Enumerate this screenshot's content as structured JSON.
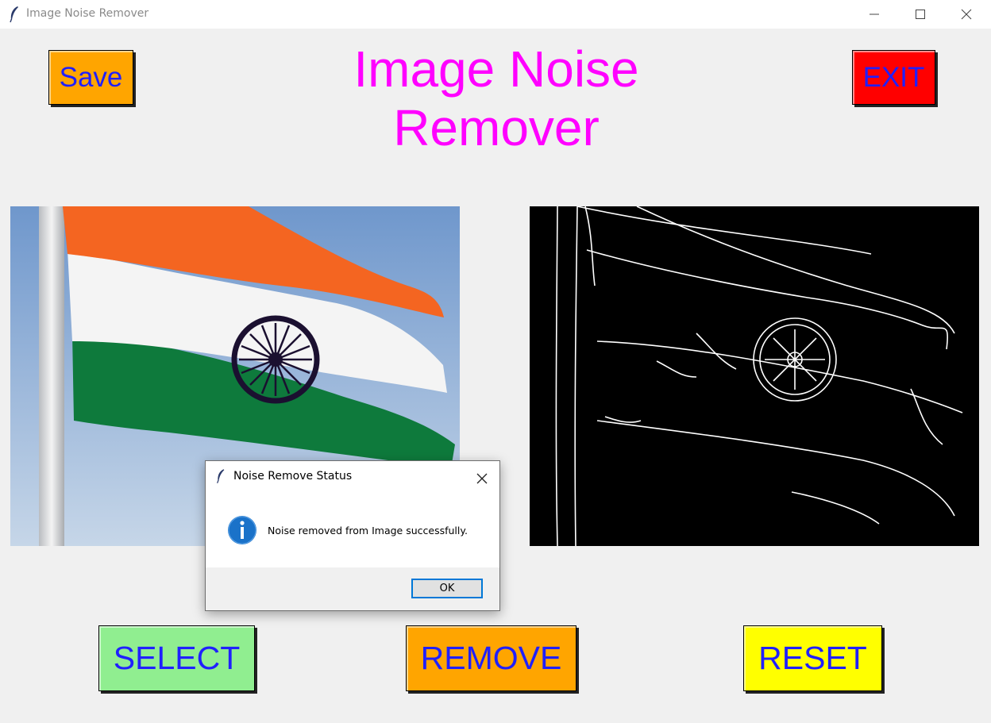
{
  "window": {
    "title": "Image Noise Remover",
    "controls": [
      "minimize-icon",
      "maximize-icon",
      "close-icon"
    ]
  },
  "header": {
    "save_label": "Save",
    "title_line1": "Image Noise",
    "title_line2": "Remover",
    "exit_label": "EXIT"
  },
  "images": {
    "original": "indian-flag-photo",
    "processed": "indian-flag-edge-detection"
  },
  "actions": {
    "select_label": "SELECT",
    "remove_label": "REMOVE",
    "reset_label": "RESET"
  },
  "dialog": {
    "title": "Noise Remove Status",
    "message": "Noise removed from Image successfully.",
    "ok_label": "OK",
    "icon": "info-icon"
  },
  "colors": {
    "title": "#ff00ff",
    "button_text": "#2020ff",
    "save_bg": "#ffa500",
    "exit_bg": "#ff0000",
    "select_bg": "#90ee90",
    "remove_bg": "#ffa500",
    "reset_bg": "#ffff00"
  }
}
